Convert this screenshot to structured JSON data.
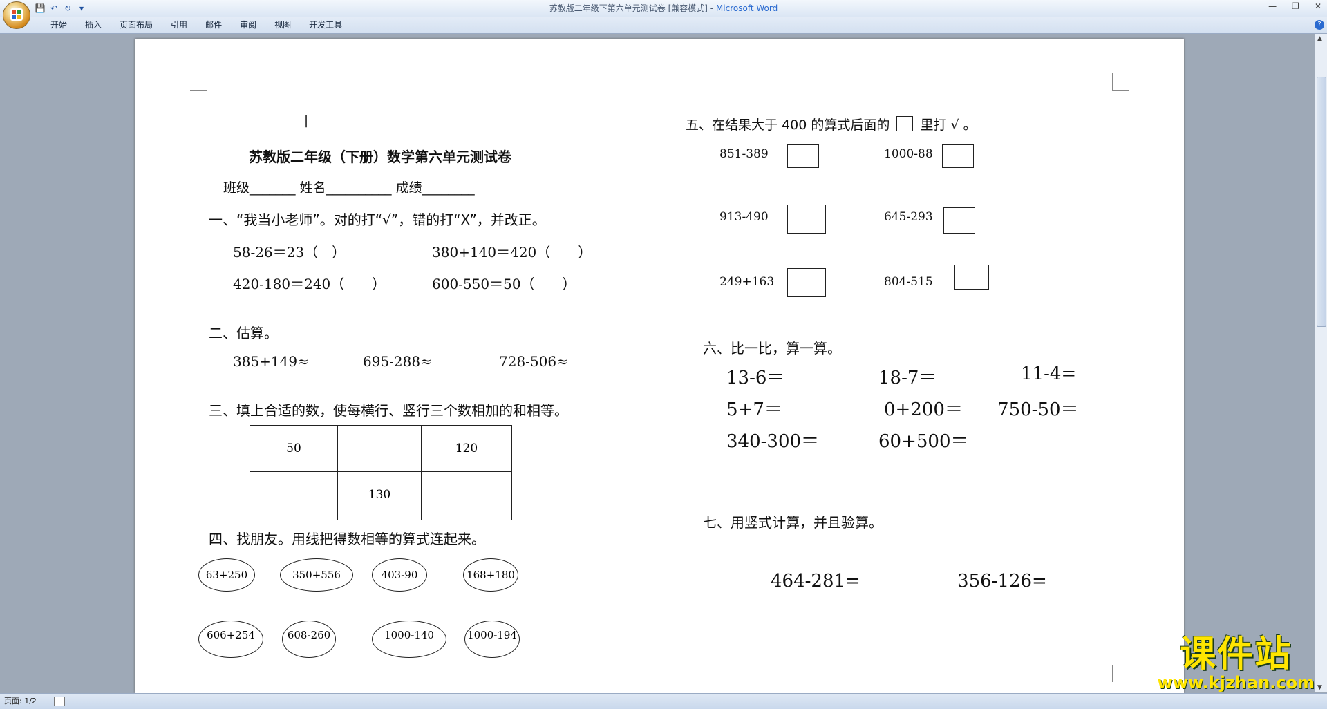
{
  "window": {
    "title_doc": "苏教版二年级下第六单元测试卷 [兼容模式] - ",
    "title_app": "Microsoft Word",
    "controls": [
      "—",
      "❐",
      "✕"
    ]
  },
  "qat": {
    "save_icon": "💾",
    "undo_icon": "↶",
    "redo_icon": "↻",
    "customize_icon": "▾"
  },
  "ribbon": {
    "tabs": [
      "开始",
      "插入",
      "页面布局",
      "引用",
      "邮件",
      "审阅",
      "视图",
      "开发工具"
    ]
  },
  "status": {
    "page": "页面: 1/2"
  },
  "doc": {
    "cursor": "|",
    "title": "苏教版二年级（下册）数学第六单元测试卷",
    "header_fields": "班级_______    姓名__________    成绩________",
    "s1": {
      "heading": "一、“我当小老师”。对的打“√”，错的打“X”，并改正。",
      "items": [
        "58-26＝23（　）",
        "380+140＝420（　　）",
        "420-180＝240（　　）",
        "600-550＝50（　　）"
      ]
    },
    "s2": {
      "heading": "二、估算。",
      "items": [
        "385+149≈",
        "695-288≈",
        "728-506≈"
      ]
    },
    "s3": {
      "heading": "三、填上合适的数，使每横行、竖行三个数相加的和相等。",
      "grid": [
        [
          "50",
          "",
          "120"
        ],
        [
          "",
          "130",
          ""
        ],
        [
          "",
          "",
          ""
        ]
      ]
    },
    "s4": {
      "heading": "四、找朋友。用线把得数相等的算式连起来。",
      "row1": [
        "63+250",
        "350+556",
        "403-90",
        "168+180"
      ],
      "row2": [
        "606+254",
        "608-260",
        "1000-140",
        "1000-194"
      ]
    },
    "s5": {
      "heading_a": "五、在结果大于 400 的算式后面的",
      "heading_b": "里打 √ 。",
      "items": [
        "851-389",
        "1000-88",
        "913-490",
        "645-293",
        "249+163",
        "804-515"
      ]
    },
    "s6": {
      "heading": "六、比一比，算一算。",
      "items": [
        "13-6＝",
        "18-7＝",
        "11-4=",
        "5+7＝",
        "0+200＝",
        "750-50＝",
        "340-300＝",
        "60+500＝"
      ]
    },
    "s7": {
      "heading": "七、用竖式计算，并且验算。",
      "items": [
        "464-281=",
        "356-126="
      ]
    }
  },
  "watermark": {
    "text": "课件站",
    "url": "www.kjzhan.com"
  }
}
